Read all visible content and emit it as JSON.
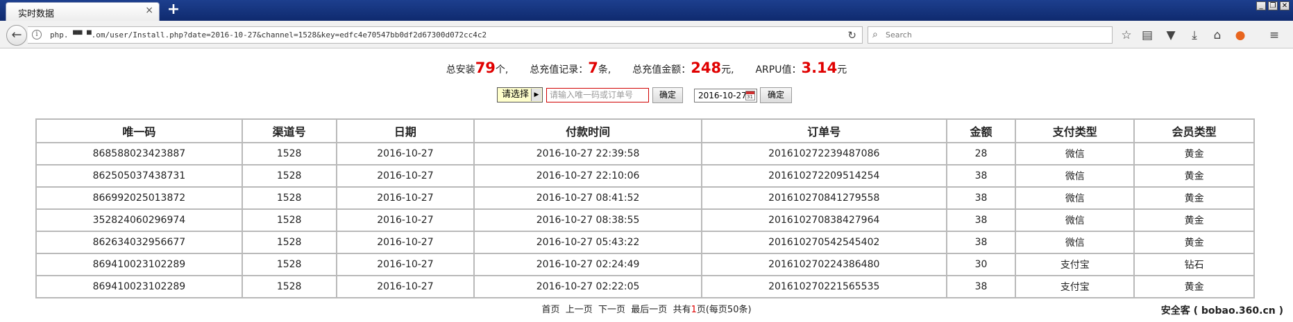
{
  "browser": {
    "tab_title": "实时数据",
    "tab_close": "×",
    "new_tab": "+",
    "url": "php.    ▀▀  ▀.om/user/Install.php?date=2016-10-27&channel=1528&key=edfc4e70547bb0df2d67300d072cc4c2",
    "search_placeholder": "Search",
    "window_controls": [
      "_",
      "❐",
      "✕"
    ]
  },
  "stats": {
    "install_label": "总安装",
    "install_value": "79",
    "install_unit": "个,",
    "recharge_records_label": "总充值记录：",
    "recharge_records_value": "7",
    "recharge_records_unit": "条,",
    "recharge_amount_label": "总充值金额：",
    "recharge_amount_value": "248",
    "recharge_amount_unit": "元,",
    "arpu_label": "ARPU值：",
    "arpu_value": "3.14",
    "arpu_unit": "元"
  },
  "filter": {
    "select_value": "请选择",
    "search_placeholder": "请输入唯一码或订单号",
    "confirm_label": "确定",
    "date_value": "2016-10-27",
    "date_confirm_label": "确定"
  },
  "table": {
    "headers": [
      "唯一码",
      "渠道号",
      "日期",
      "付款时间",
      "订单号",
      "金额",
      "支付类型",
      "会员类型"
    ],
    "rows": [
      [
        "868588023423887",
        "1528",
        "2016-10-27",
        "2016-10-27 22:39:58",
        "201610272239487086",
        "28",
        "微信",
        "黄金"
      ],
      [
        "862505037438731",
        "1528",
        "2016-10-27",
        "2016-10-27 22:10:06",
        "201610272209514254",
        "38",
        "微信",
        "黄金"
      ],
      [
        "866992025013872",
        "1528",
        "2016-10-27",
        "2016-10-27 08:41:52",
        "201610270841279558",
        "38",
        "微信",
        "黄金"
      ],
      [
        "352824060296974",
        "1528",
        "2016-10-27",
        "2016-10-27 08:38:55",
        "201610270838427964",
        "38",
        "微信",
        "黄金"
      ],
      [
        "862634032956677",
        "1528",
        "2016-10-27",
        "2016-10-27 05:43:22",
        "201610270542545402",
        "38",
        "微信",
        "黄金"
      ],
      [
        "869410023102289",
        "1528",
        "2016-10-27",
        "2016-10-27 02:24:49",
        "201610270224386480",
        "30",
        "支付宝",
        "钻石"
      ],
      [
        "869410023102289",
        "1528",
        "2016-10-27",
        "2016-10-27 02:22:05",
        "201610270221565535",
        "38",
        "支付宝",
        "黄金"
      ]
    ]
  },
  "pager": {
    "first": "首页",
    "prev": "上一页",
    "next": "下一页",
    "last": "最后一页",
    "total_prefix": "共有",
    "total_pages": "1",
    "total_suffix": "页(每页50条)"
  },
  "watermark": "安全客 ( bobao.360.cn )"
}
